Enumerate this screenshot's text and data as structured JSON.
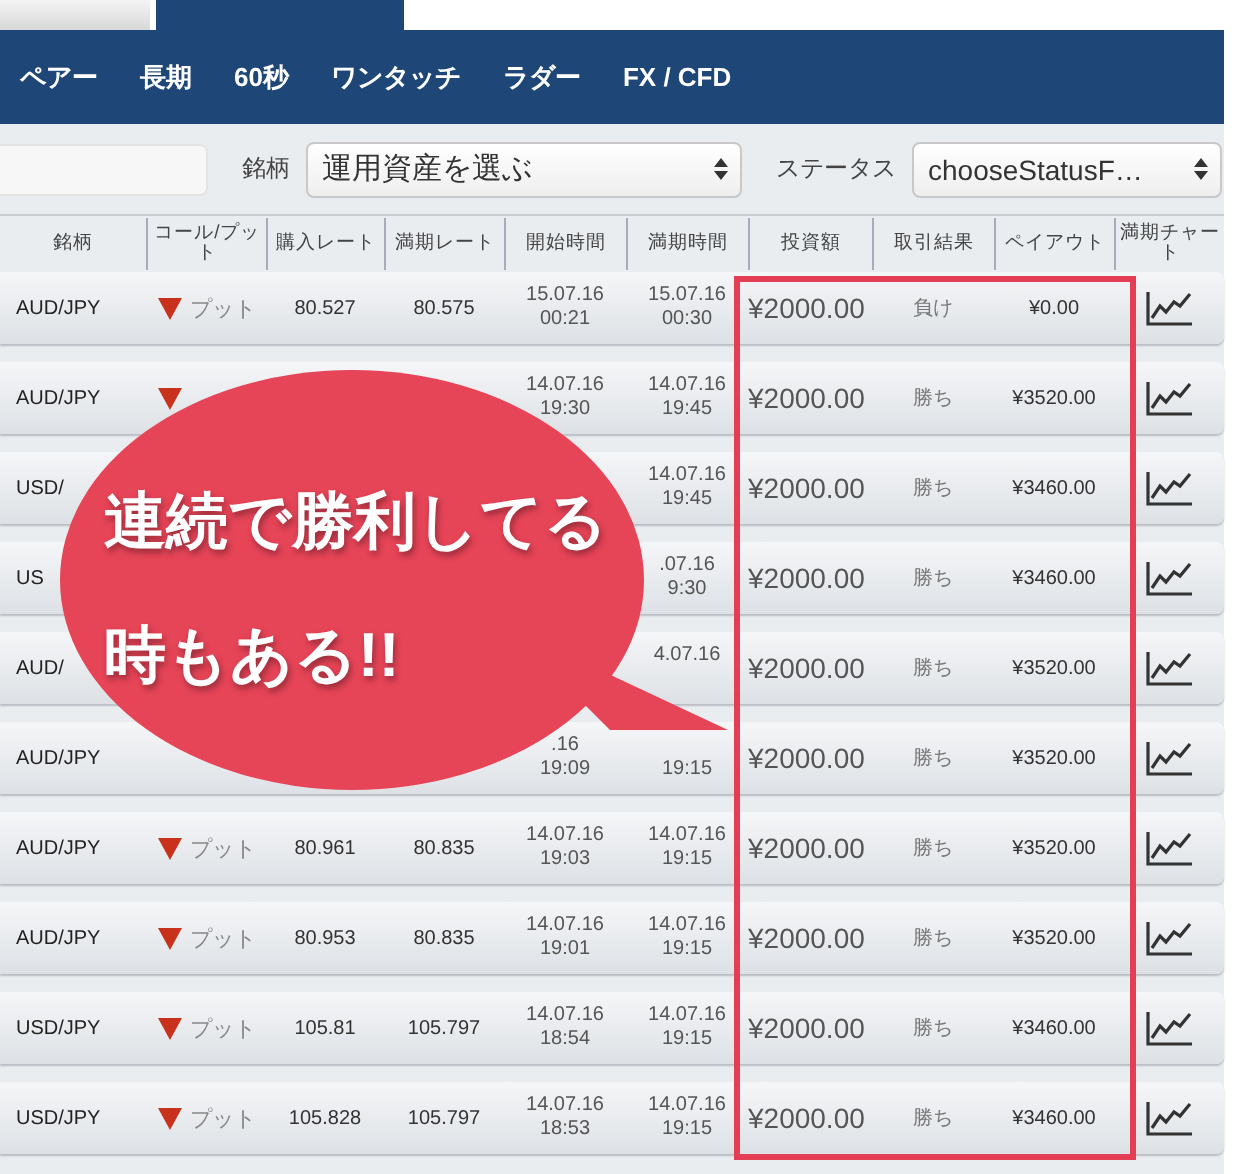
{
  "tabs": [
    {
      "selected": false
    },
    {
      "selected": true
    }
  ],
  "nav": {
    "items": [
      "ペアー",
      "長期",
      "60秒",
      "ワンタッチ",
      "ラダー",
      "FX / CFD"
    ]
  },
  "filters": {
    "asset_label": "銘柄",
    "asset_value": "運用資産を選ぶ",
    "status_label": "ステータス",
    "status_value": "chooseStatusF…"
  },
  "table": {
    "columns": [
      "銘柄",
      "コール/プット",
      "購入レート",
      "満期レート",
      "開始時間",
      "満期時間",
      "投資額",
      "取引結果",
      "ペイアウト",
      "満期チャート"
    ],
    "rows": [
      {
        "pair": "AUD/JPY",
        "kind": "put",
        "direction_label": "プット",
        "buy_rate": "80.527",
        "expiry_rate": "80.575",
        "start": {
          "date": "15.07.16",
          "time": "00:21"
        },
        "end": {
          "date": "15.07.16",
          "time": "00:30"
        },
        "amount": "¥2000.00",
        "result": "負け",
        "payout": "¥0.00"
      },
      {
        "pair": "AUD/JPY",
        "kind": "put",
        "start": {
          "date": "14.07.16",
          "time": "19:30"
        },
        "end": {
          "date": "14.07.16",
          "time": "19:45"
        },
        "amount": "¥2000.00",
        "result": "勝ち",
        "payout": "¥3520.00"
      },
      {
        "pair": "USD/",
        "end": {
          "date": "14.07.16",
          "time": "19:45"
        },
        "amount": "¥2000.00",
        "result": "勝ち",
        "payout": "¥3460.00"
      },
      {
        "pair": "US",
        "end": {
          "date": ".07.16",
          "time": "9:30"
        },
        "amount": "¥2000.00",
        "result": "勝ち",
        "payout": "¥3460.00"
      },
      {
        "pair": "AUD/",
        "end": {
          "date": "4.07.16"
        },
        "amount": "¥2000.00",
        "result": "勝ち",
        "payout": "¥3520.00"
      },
      {
        "pair": "AUD/JPY",
        "start": {
          "date": ".16",
          "time": "19:09"
        },
        "end": {
          "time": "19:15"
        },
        "amount": "¥2000.00",
        "result": "勝ち",
        "payout": "¥3520.00"
      },
      {
        "pair": "AUD/JPY",
        "kind": "put",
        "direction_label": "プット",
        "buy_rate": "80.961",
        "expiry_rate": "80.835",
        "start": {
          "date": "14.07.16",
          "time": "19:03"
        },
        "end": {
          "date": "14.07.16",
          "time": "19:15"
        },
        "amount": "¥2000.00",
        "result": "勝ち",
        "payout": "¥3520.00"
      },
      {
        "pair": "AUD/JPY",
        "kind": "put",
        "direction_label": "プット",
        "buy_rate": "80.953",
        "expiry_rate": "80.835",
        "start": {
          "date": "14.07.16",
          "time": "19:01"
        },
        "end": {
          "date": "14.07.16",
          "time": "19:15"
        },
        "amount": "¥2000.00",
        "result": "勝ち",
        "payout": "¥3520.00"
      },
      {
        "pair": "USD/JPY",
        "kind": "put",
        "direction_label": "プット",
        "buy_rate": "105.81",
        "expiry_rate": "105.797",
        "start": {
          "date": "14.07.16",
          "time": "18:54"
        },
        "end": {
          "date": "14.07.16",
          "time": "19:15"
        },
        "amount": "¥2000.00",
        "result": "勝ち",
        "payout": "¥3460.00"
      },
      {
        "pair": "USD/JPY",
        "kind": "put",
        "direction_label": "プット",
        "buy_rate": "105.828",
        "expiry_rate": "105.797",
        "start": {
          "date": "14.07.16",
          "time": "18:53"
        },
        "end": {
          "date": "14.07.16",
          "time": "19:15"
        },
        "amount": "¥2000.00",
        "result": "勝ち",
        "payout": "¥3460.00"
      }
    ]
  },
  "callout": {
    "lines": [
      "連続で勝利してる",
      "時もある!!"
    ]
  }
}
